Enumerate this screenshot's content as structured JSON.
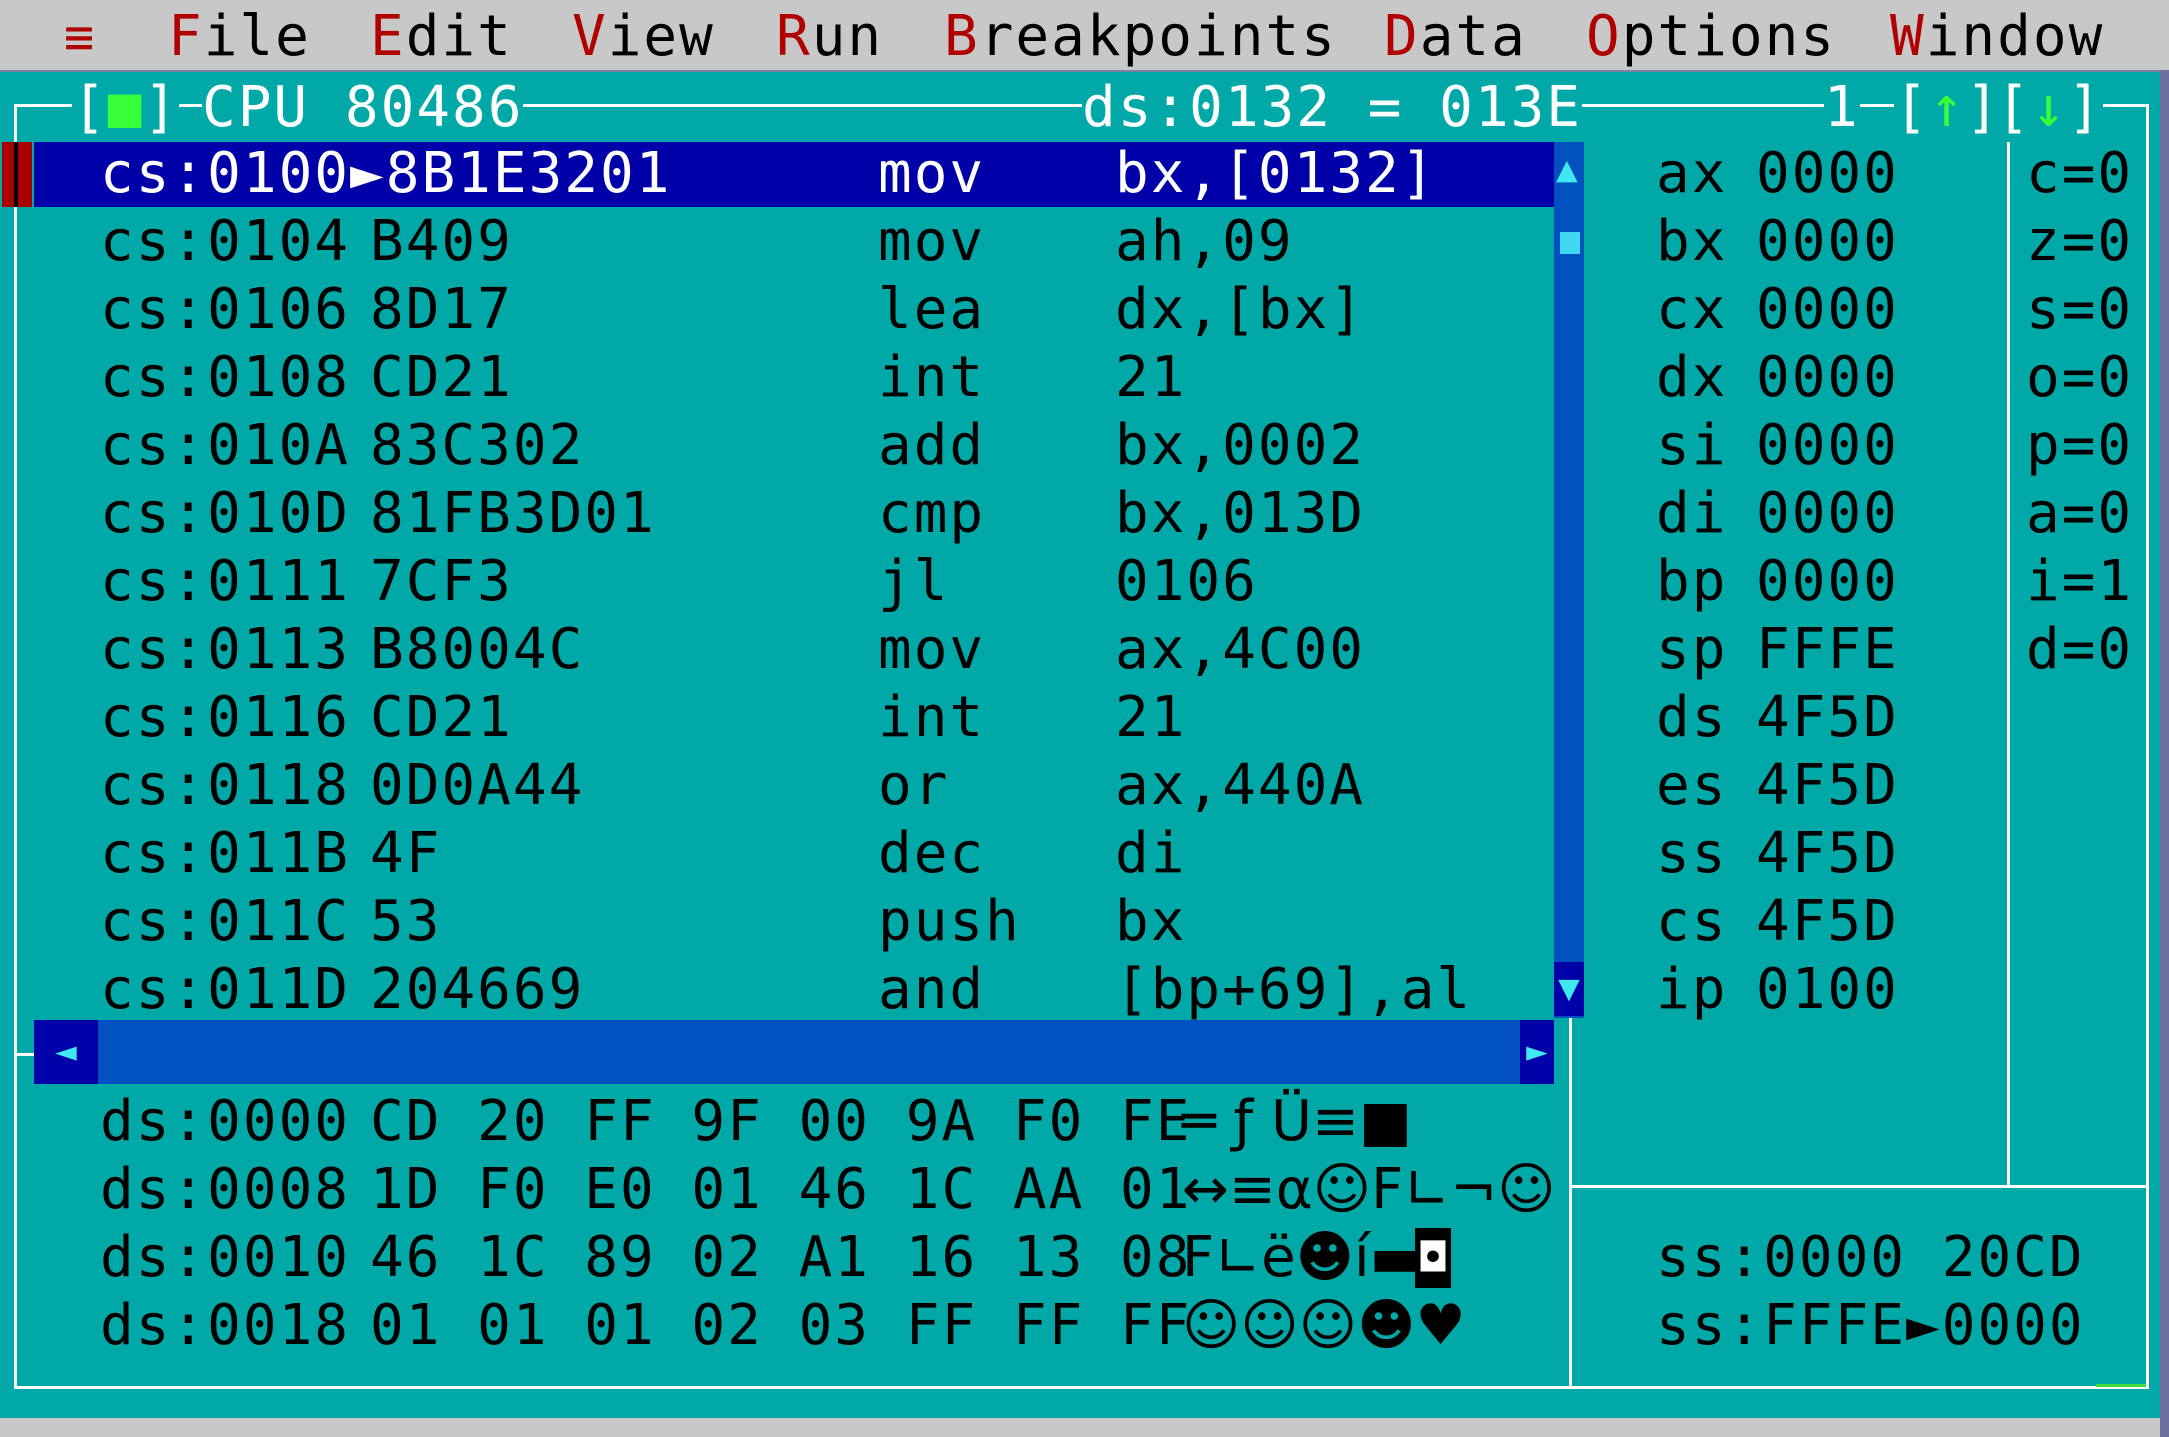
{
  "menu": {
    "system": "≡",
    "items": [
      {
        "hot": "F",
        "rest": "ile"
      },
      {
        "hot": "E",
        "rest": "dit"
      },
      {
        "hot": "V",
        "rest": "iew"
      },
      {
        "hot": "R",
        "rest": "un"
      },
      {
        "hot": "B",
        "rest": "reakpoints"
      },
      {
        "hot": "D",
        "rest": "ata"
      },
      {
        "hot": "O",
        "rest": "ptions"
      },
      {
        "hot": "W",
        "rest": "indow"
      }
    ]
  },
  "window": {
    "close_left": "[",
    "close_glyph": "■",
    "close_right": "]",
    "title": "CPU 80486",
    "ds_info": "ds:0132 = 013E",
    "number": "1",
    "up_arrow": "↑",
    "down_arrow": "↓"
  },
  "code": [
    {
      "addr": "cs:0100",
      "ptr": "►",
      "hex": "8B1E3201",
      "mnem": "mov",
      "ops": "bx,[0132]"
    },
    {
      "addr": "cs:0104",
      "ptr": " ",
      "hex": "B409",
      "mnem": "mov",
      "ops": "ah,09"
    },
    {
      "addr": "cs:0106",
      "ptr": " ",
      "hex": "8D17",
      "mnem": "lea",
      "ops": "dx,[bx]"
    },
    {
      "addr": "cs:0108",
      "ptr": " ",
      "hex": "CD21",
      "mnem": "int",
      "ops": "21"
    },
    {
      "addr": "cs:010A",
      "ptr": " ",
      "hex": "83C302",
      "mnem": "add",
      "ops": "bx,0002"
    },
    {
      "addr": "cs:010D",
      "ptr": " ",
      "hex": "81FB3D01",
      "mnem": "cmp",
      "ops": "bx,013D"
    },
    {
      "addr": "cs:0111",
      "ptr": " ",
      "hex": "7CF3",
      "mnem": "jl",
      "ops": "0106"
    },
    {
      "addr": "cs:0113",
      "ptr": " ",
      "hex": "B8004C",
      "mnem": "mov",
      "ops": "ax,4C00"
    },
    {
      "addr": "cs:0116",
      "ptr": " ",
      "hex": "CD21",
      "mnem": "int",
      "ops": "21"
    },
    {
      "addr": "cs:0118",
      "ptr": " ",
      "hex": "0D0A44",
      "mnem": "or",
      "ops": "ax,440A"
    },
    {
      "addr": "cs:011B",
      "ptr": " ",
      "hex": "4F",
      "mnem": "dec",
      "ops": "di"
    },
    {
      "addr": "cs:011C",
      "ptr": " ",
      "hex": "53",
      "mnem": "push",
      "ops": "bx"
    },
    {
      "addr": "cs:011D",
      "ptr": " ",
      "hex": "204669",
      "mnem": "and",
      "ops": "[bp+69],al"
    }
  ],
  "registers": [
    {
      "name": "ax",
      "value": "0000"
    },
    {
      "name": "bx",
      "value": "0000"
    },
    {
      "name": "cx",
      "value": "0000"
    },
    {
      "name": "dx",
      "value": "0000"
    },
    {
      "name": "si",
      "value": "0000"
    },
    {
      "name": "di",
      "value": "0000"
    },
    {
      "name": "bp",
      "value": "0000"
    },
    {
      "name": "sp",
      "value": "FFFE"
    },
    {
      "name": "ds",
      "value": "4F5D"
    },
    {
      "name": "es",
      "value": "4F5D"
    },
    {
      "name": "ss",
      "value": "4F5D"
    },
    {
      "name": "cs",
      "value": "4F5D"
    },
    {
      "name": "ip",
      "value": "0100"
    }
  ],
  "flags": [
    "c=0",
    "z=0",
    "s=0",
    "o=0",
    "p=0",
    "a=0",
    "i=1",
    "d=0"
  ],
  "dump": [
    {
      "addr": "ds:0000",
      "bytes": "CD 20 FF 9F 00 9A F0 FE",
      "ascii": "═ ƒ Ü≡■"
    },
    {
      "addr": "ds:0008",
      "bytes": "1D F0 E0 01 46 1C AA 01",
      "ascii": "↔≡α☺F∟¬☺"
    },
    {
      "addr": "ds:0010",
      "bytes": "46 1C 89 02 A1 16 13 08",
      "ascii": "F∟ë☻í▬‼"
    },
    {
      "addr": "ds:0018",
      "bytes": "01 01 01 02 03 FF FF FF",
      "ascii": "☺☺☺☻♥"
    }
  ],
  "dump_cursor": "◘",
  "stack": [
    {
      "addr": "ss:0000",
      "ptr": " ",
      "value": "20CD"
    },
    {
      "addr": "ss:FFFE",
      "ptr": "►",
      "value": "0000"
    }
  ],
  "scroll": {
    "up": "▲",
    "down": "▼",
    "left": "◄",
    "right": "►"
  }
}
